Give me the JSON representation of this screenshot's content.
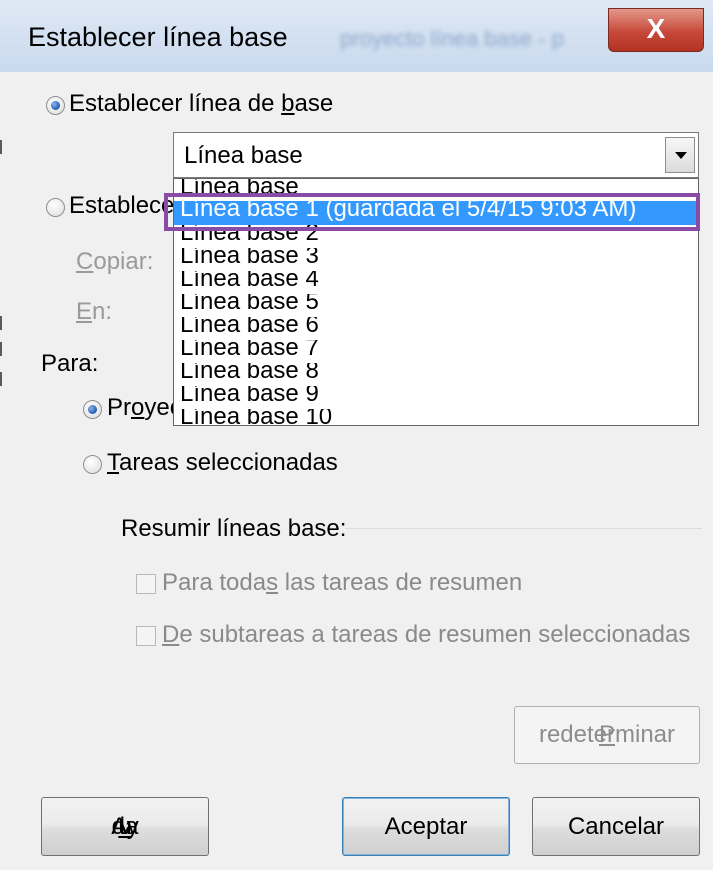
{
  "window": {
    "title": "Establecer línea base",
    "background_title": "proyecto línea base - p",
    "close_glyph": "X"
  },
  "set_baseline": {
    "label_pre": "Establecer línea de ",
    "label_u": "b",
    "label_post": "ase",
    "selected": true
  },
  "combo": {
    "value": "Línea base"
  },
  "dropdown": {
    "options": [
      "Línea base",
      "Línea base 1 (guardada el 5/4/15 9:03 AM)",
      "Línea base 2",
      "Línea base 3",
      "Línea base 4",
      "Línea base 5",
      "Línea base 6",
      "Línea base 7",
      "Línea base 8",
      "Línea base 9",
      "Línea base 10"
    ],
    "highlighted_index": 1
  },
  "set_interim": {
    "label": "Establecer",
    "selected": false
  },
  "copy": {
    "label_u": "C",
    "label_rest": "opiar:"
  },
  "into": {
    "label_u": "E",
    "label_rest": "n:"
  },
  "for_section": {
    "label": "Para:",
    "entire_project": {
      "label_pre": "Pr",
      "label_u": "o",
      "label_post": "yec",
      "selected": true
    },
    "selected_tasks": {
      "label_u": "T",
      "label_rest": "areas seleccionadas",
      "selected": false
    }
  },
  "rollup": {
    "title": "Resumir líneas base:",
    "option1": {
      "pre": "Para toda",
      "u": "s",
      "post": " las tareas de resumen",
      "checked": false
    },
    "option2": {
      "u": "D",
      "rest": "e subtareas a tareas de resumen seleccionadas",
      "checked": false
    }
  },
  "buttons": {
    "set_default_u": "P",
    "set_default_rest": "redeterminar",
    "help_pre": "Ay",
    "help_u": "u",
    "help_post": "da",
    "ok": "Aceptar",
    "cancel": "Cancelar"
  },
  "colors": {
    "selection": "#3399ff",
    "highlight_box": "#8a4ba6",
    "close_button": "#c7483a"
  }
}
